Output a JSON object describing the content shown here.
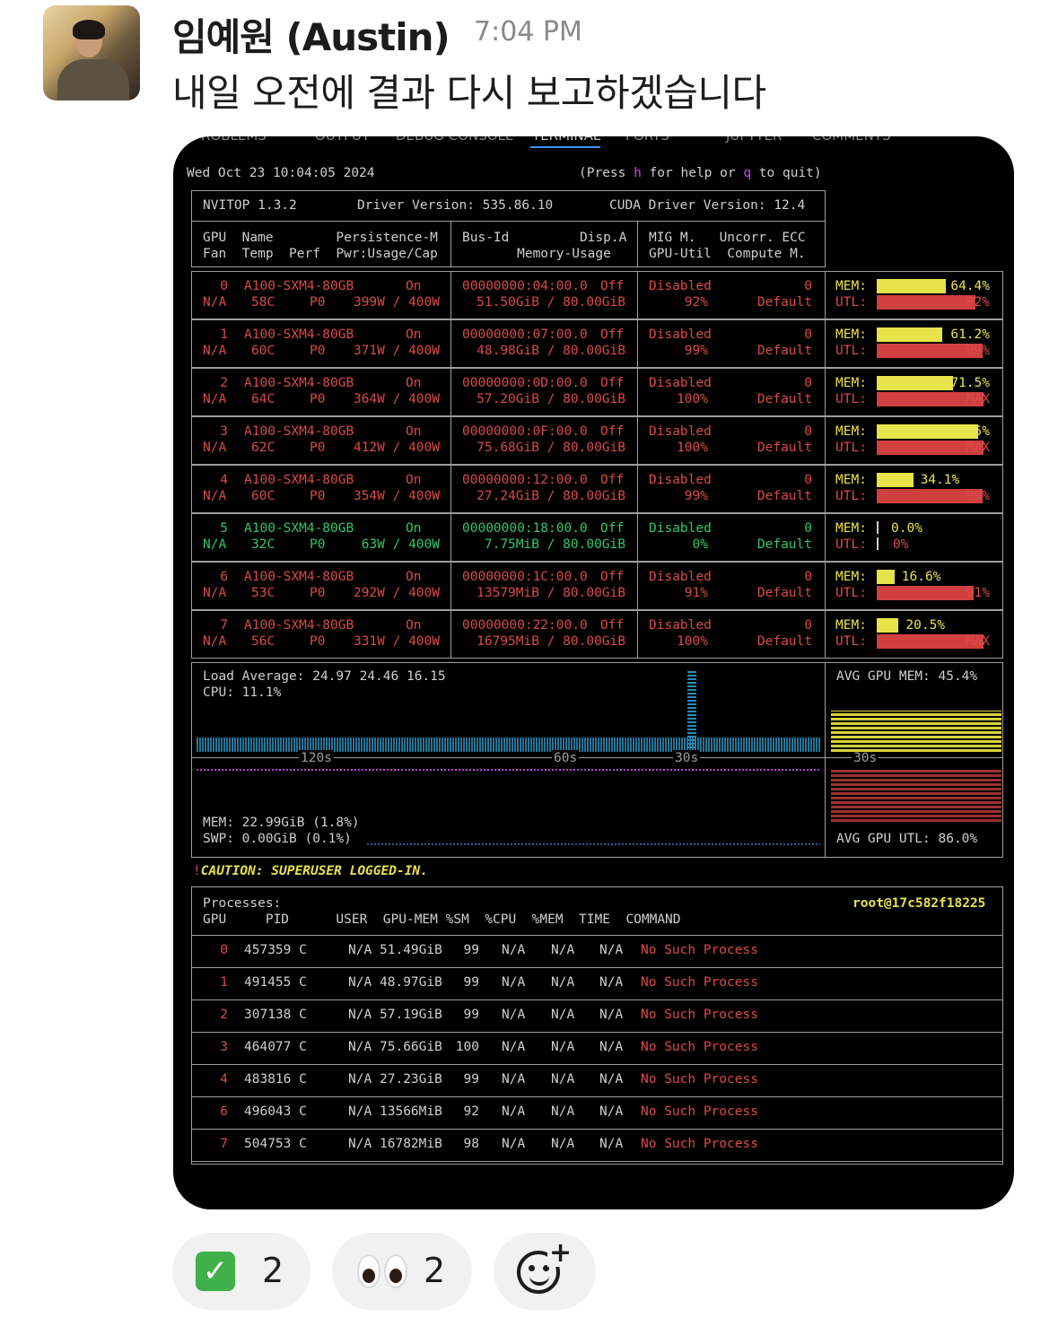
{
  "message": {
    "sender": "임예원 (Austin)",
    "time": "7:04 PM",
    "text": "내일 오전에 결과 다시 보고하겠습니다"
  },
  "vscode_tabs": [
    "PROBLEMS",
    "OUTPUT",
    "DEBUG CONSOLE",
    "TERMINAL",
    "PORTS",
    "JUPYTER",
    "COMMENTS"
  ],
  "terminal": {
    "datetime": "Wed Oct 23 10:04:05 2024",
    "help": "(Press h for help or q to quit)",
    "nvitop_version": "NVITOP 1.3.2",
    "driver_version": "Driver Version: 535.86.10",
    "cuda_version": "CUDA Driver Version: 12.4",
    "headers": {
      "c1r1": "GPU  Name        Persistence-M",
      "c1r2": "Fan  Temp  Perf  Pwr:Usage/Cap",
      "c2r1": "Bus-Id         Disp.A",
      "c2r2": "       Memory-Usage",
      "c3r1": "MIG M.   Uncorr. ECC",
      "c3r2": "GPU-Util  Compute M."
    },
    "gpus": [
      {
        "id": "0",
        "name": "A100-SXM4-80GB",
        "persistence": "On",
        "fan": "N/A",
        "temp": "58C",
        "perf": "P0",
        "power": "399W / 400W",
        "bus": "00000000:04:00.0",
        "disp": "Off",
        "mem": "51.50GiB / 80.00GiB",
        "mig": "Disabled",
        "util": "92%",
        "ecc": "0",
        "compute": "Default",
        "mem_pct": "64.4%",
        "utl_label": "92%",
        "mem_frac": 0.644,
        "utl_frac": 0.92,
        "color": "red"
      },
      {
        "id": "1",
        "name": "A100-SXM4-80GB",
        "persistence": "On",
        "fan": "N/A",
        "temp": "60C",
        "perf": "P0",
        "power": "371W / 400W",
        "bus": "00000000:07:00.0",
        "disp": "Off",
        "mem": "48.98GiB / 80.00GiB",
        "mig": "Disabled",
        "util": "99%",
        "ecc": "0",
        "compute": "Default",
        "mem_pct": "61.2%",
        "utl_label": "99%",
        "mem_frac": 0.612,
        "utl_frac": 0.99,
        "color": "red"
      },
      {
        "id": "2",
        "name": "A100-SXM4-80GB",
        "persistence": "On",
        "fan": "N/A",
        "temp": "64C",
        "perf": "P0",
        "power": "364W / 400W",
        "bus": "00000000:0D:00.0",
        "disp": "Off",
        "mem": "57.20GiB / 80.00GiB",
        "mig": "Disabled",
        "util": "100%",
        "ecc": "0",
        "compute": "Default",
        "mem_pct": "71.5%",
        "utl_label": "MAX",
        "mem_frac": 0.715,
        "utl_frac": 1.0,
        "color": "red"
      },
      {
        "id": "3",
        "name": "A100-SXM4-80GB",
        "persistence": "On",
        "fan": "N/A",
        "temp": "62C",
        "perf": "P0",
        "power": "412W / 400W",
        "bus": "00000000:0F:00.0",
        "disp": "Off",
        "mem": "75.68GiB / 80.00GiB",
        "mig": "Disabled",
        "util": "100%",
        "ecc": "0",
        "compute": "Default",
        "mem_pct": "95%",
        "utl_label": "MAX",
        "mem_frac": 0.95,
        "utl_frac": 1.0,
        "color": "red"
      },
      {
        "id": "4",
        "name": "A100-SXM4-80GB",
        "persistence": "On",
        "fan": "N/A",
        "temp": "60C",
        "perf": "P0",
        "power": "354W / 400W",
        "bus": "00000000:12:00.0",
        "disp": "Off",
        "mem": "27.24GiB / 80.00GiB",
        "mig": "Disabled",
        "util": "99%",
        "ecc": "0",
        "compute": "Default",
        "mem_pct": "34.1%",
        "utl_label": "99%",
        "mem_frac": 0.341,
        "utl_frac": 0.99,
        "color": "red"
      },
      {
        "id": "5",
        "name": "A100-SXM4-80GB",
        "persistence": "On",
        "fan": "N/A",
        "temp": "32C",
        "perf": "P0",
        "power": "63W / 400W",
        "bus": "00000000:18:00.0",
        "disp": "Off",
        "mem": "7.75MiB / 80.00GiB",
        "mig": "Disabled",
        "util": "0%",
        "ecc": "0",
        "compute": "Default",
        "mem_pct": "0.0%",
        "utl_label": "0%",
        "mem_frac": 0.0,
        "utl_frac": 0.0,
        "color": "grn"
      },
      {
        "id": "6",
        "name": "A100-SXM4-80GB",
        "persistence": "On",
        "fan": "N/A",
        "temp": "53C",
        "perf": "P0",
        "power": "292W / 400W",
        "bus": "00000000:1C:00.0",
        "disp": "Off",
        "mem": "13579MiB / 80.00GiB",
        "mig": "Disabled",
        "util": "91%",
        "ecc": "0",
        "compute": "Default",
        "mem_pct": "16.6%",
        "utl_label": "91%",
        "mem_frac": 0.166,
        "utl_frac": 0.91,
        "color": "red"
      },
      {
        "id": "7",
        "name": "A100-SXM4-80GB",
        "persistence": "On",
        "fan": "N/A",
        "temp": "56C",
        "perf": "P0",
        "power": "331W / 400W",
        "bus": "00000000:22:00.0",
        "disp": "Off",
        "mem": "16795MiB / 80.00GiB",
        "mig": "Disabled",
        "util": "100%",
        "ecc": "0",
        "compute": "Default",
        "mem_pct": "20.5%",
        "utl_label": "MAX",
        "mem_frac": 0.205,
        "utl_frac": 1.0,
        "color": "red"
      }
    ],
    "mem_label": "MEM:",
    "utl_label": "UTL:",
    "load_average": "Load Average: 24.97 24.46 16.15",
    "cpu": "CPU: 11.1%",
    "mem": "MEM: 22.99GiB (1.8%)",
    "swp": "SWP: 0.00GiB (0.1%)",
    "avg_gpu_mem": "AVG GPU MEM: 45.4%",
    "avg_gpu_utl": "AVG GPU UTL: 86.0%",
    "tick_120": "120s",
    "tick_60": "60s",
    "tick_30": "30s",
    "tick_30b": "30s",
    "tick_30c": "30s",
    "caution_bang": "!",
    "caution": "CAUTION: SUPERUSER LOGGED-IN.",
    "processes_label": "Processes:",
    "user_host": "root@17c582f18225",
    "proc_headers": "GPU     PID      USER  GPU-MEM %SM  %CPU  %MEM  TIME  COMMAND",
    "processes": [
      {
        "gpu": "0",
        "pid": "457359 C",
        "user": "N/A",
        "gpumem": "51.49GiB",
        "sm": "99",
        "cpu": "N/A",
        "mem": "N/A",
        "time": "N/A",
        "command": "No Such Process"
      },
      {
        "gpu": "1",
        "pid": "491455 C",
        "user": "N/A",
        "gpumem": "48.97GiB",
        "sm": "99",
        "cpu": "N/A",
        "mem": "N/A",
        "time": "N/A",
        "command": "No Such Process"
      },
      {
        "gpu": "2",
        "pid": "307138 C",
        "user": "N/A",
        "gpumem": "57.19GiB",
        "sm": "99",
        "cpu": "N/A",
        "mem": "N/A",
        "time": "N/A",
        "command": "No Such Process"
      },
      {
        "gpu": "3",
        "pid": "464077 C",
        "user": "N/A",
        "gpumem": "75.66GiB",
        "sm": "100",
        "cpu": "N/A",
        "mem": "N/A",
        "time": "N/A",
        "command": "No Such Process"
      },
      {
        "gpu": "4",
        "pid": "483816 C",
        "user": "N/A",
        "gpumem": "27.23GiB",
        "sm": "99",
        "cpu": "N/A",
        "mem": "N/A",
        "time": "N/A",
        "command": "No Such Process"
      },
      {
        "gpu": "6",
        "pid": "496043 C",
        "user": "N/A",
        "gpumem": "13566MiB",
        "sm": "92",
        "cpu": "N/A",
        "mem": "N/A",
        "time": "N/A",
        "command": "No Such Process"
      },
      {
        "gpu": "7",
        "pid": "504753 C",
        "user": "N/A",
        "gpumem": "16782MiB",
        "sm": "98",
        "cpu": "N/A",
        "mem": "N/A",
        "time": "N/A",
        "command": "No Such Process"
      }
    ]
  },
  "reactions": [
    {
      "emoji": "check-mark-icon",
      "count": "2"
    },
    {
      "emoji": "eyes-icon",
      "count": "2"
    }
  ],
  "colors": {
    "mem_bar": "#e7e34a",
    "utl_bar": "#d23f3f",
    "gpu_busy": "#d94a4a",
    "gpu_idle": "#35c46a",
    "caution": "#e7e34a"
  }
}
